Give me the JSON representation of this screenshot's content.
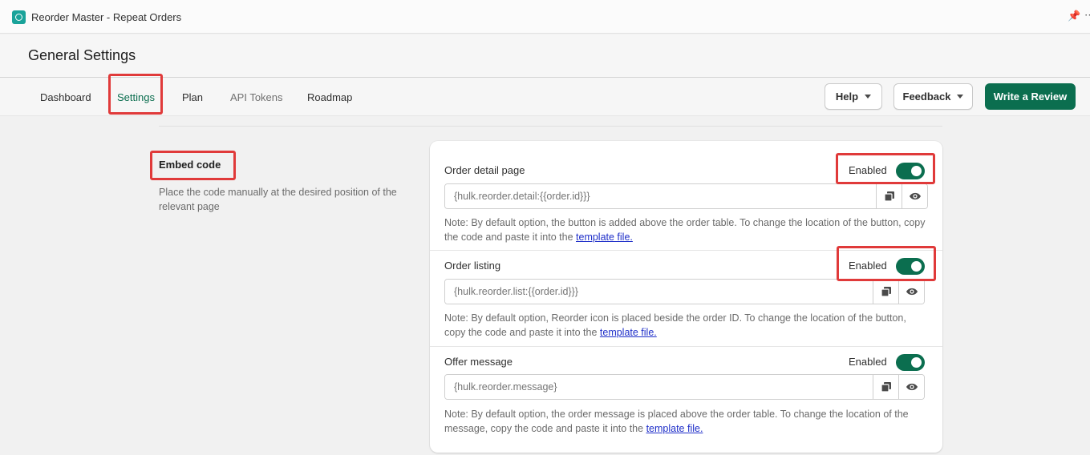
{
  "app": {
    "title": "Reorder Master - Repeat Orders"
  },
  "header": {
    "title": "General Settings"
  },
  "tabs": [
    {
      "label": "Dashboard"
    },
    {
      "label": "Settings"
    },
    {
      "label": "Plan"
    },
    {
      "label": "API Tokens"
    },
    {
      "label": "Roadmap"
    }
  ],
  "actions": {
    "help_label": "Help",
    "feedback_label": "Feedback",
    "review_label": "Write a Review"
  },
  "section": {
    "title": "Embed code",
    "description": "Place the code manually at the desired position of the relevant page"
  },
  "rows": [
    {
      "label": "Order detail page",
      "status": "Enabled",
      "code": "{hulk.reorder.detail:{{order.id}}}",
      "note_text": "Note: By default option, the button is added above the order table. To change the location of the button, copy the code and paste it into the ",
      "link": "template file."
    },
    {
      "label": "Order listing",
      "status": "Enabled",
      "code": "{hulk.reorder.list:{{order.id}}}",
      "note_text": "Note: By default option, Reorder icon is placed beside the order ID. To change the location of the button, copy the code and paste it into the ",
      "link": "template file."
    },
    {
      "label": "Offer message",
      "status": "Enabled",
      "code": "{hulk.reorder.message}",
      "note_text": "Note: By default option, the order message is placed above the order table. To change the location of the message, copy the code and paste it into the ",
      "link": "template file."
    }
  ],
  "colors": {
    "accent": "#0b6e4f",
    "highlight": "#e03a3a",
    "link": "#1f2fc9"
  },
  "icons": [
    "app-logo-icon",
    "pin-icon",
    "more-icon",
    "chevron-down-icon",
    "copy-icon",
    "eye-icon"
  ]
}
